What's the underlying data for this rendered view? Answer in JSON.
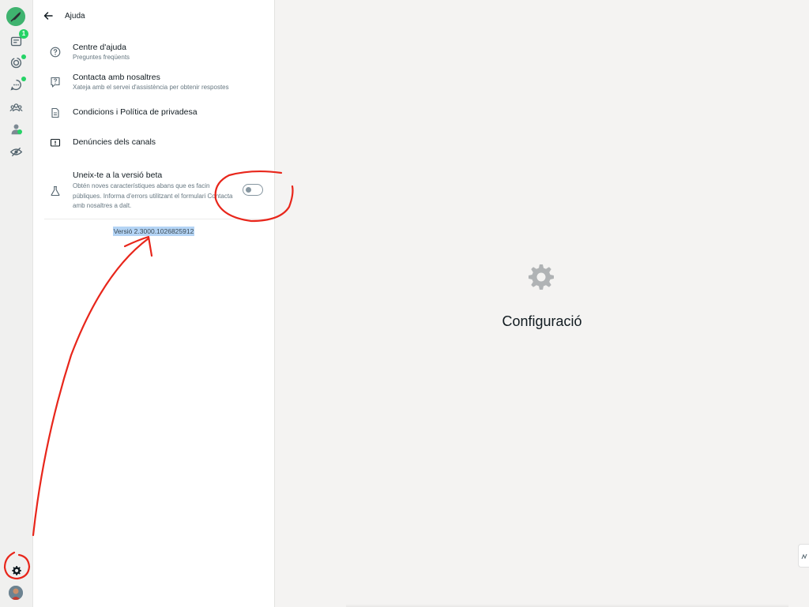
{
  "rail": {
    "chats_badge": "1"
  },
  "panel": {
    "header_title": "Ajuda",
    "items": [
      {
        "title": "Centre d'ajuda",
        "subtitle": "Preguntes freqüents"
      },
      {
        "title": "Contacta amb nosaltres",
        "subtitle": "Xateja amb el servei d'assistència per obtenir respostes"
      },
      {
        "title": "Condicions i Política de privadesa"
      },
      {
        "title": "Denúncies dels canals"
      }
    ],
    "beta": {
      "title": "Uneix-te a la versió beta",
      "description": "Obtén noves característiques abans que es facin públiques. Informa d'errors utilitzant el formulari Contacta amb nosaltres a dalt.",
      "toggle_on": false
    },
    "version": "Versió 2.3000.1026825912"
  },
  "main": {
    "title": "Configuració",
    "icon": "gear-icon"
  },
  "colors": {
    "accent_green": "#25d366",
    "annotation_red": "#e8261b",
    "selection_blue": "#b4d4f5"
  }
}
